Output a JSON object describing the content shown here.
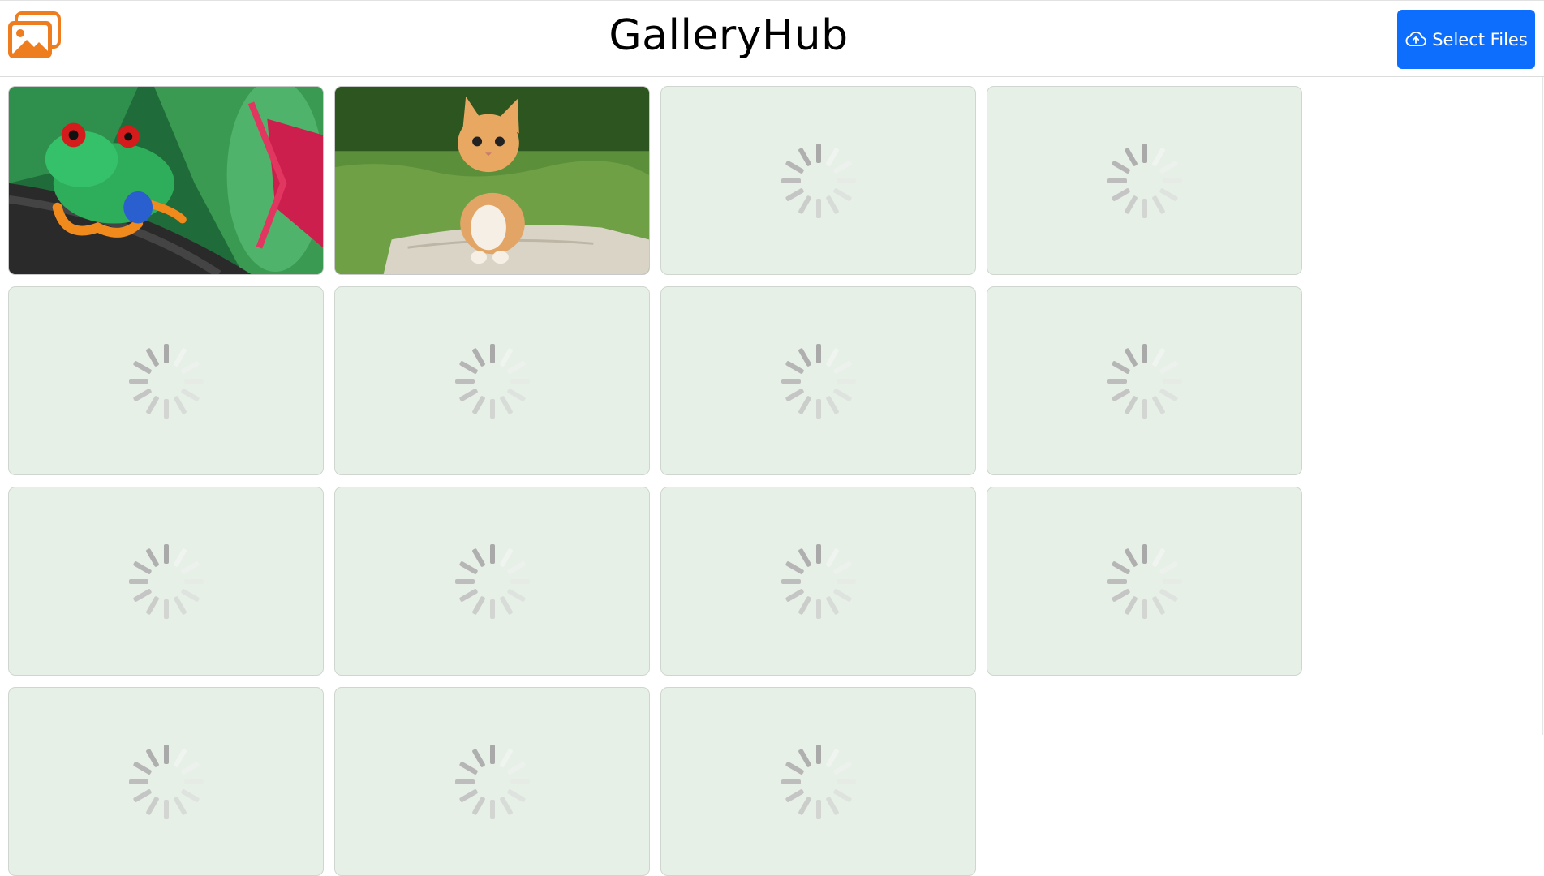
{
  "header": {
    "title": "GalleryHub",
    "logo_icon": "images-icon",
    "select_button_label": "Select Files",
    "select_button_icon": "cloud-upload-icon",
    "accent_color": "#0d6efd",
    "logo_color": "#ee7d1f"
  },
  "gallery": {
    "tiles": [
      {
        "state": "loaded",
        "subject": "red-eyed tree frog"
      },
      {
        "state": "loaded",
        "subject": "orange kitten on grass"
      },
      {
        "state": "loading"
      },
      {
        "state": "loading"
      },
      {
        "state": "loading"
      },
      {
        "state": "loading"
      },
      {
        "state": "loading"
      },
      {
        "state": "loading"
      },
      {
        "state": "loading"
      },
      {
        "state": "loading"
      },
      {
        "state": "loading"
      },
      {
        "state": "loading"
      },
      {
        "state": "loading"
      },
      {
        "state": "loading"
      },
      {
        "state": "loading"
      }
    ],
    "tile_background": "#e6f0e6",
    "spinner_color": "#a8a8a8"
  }
}
